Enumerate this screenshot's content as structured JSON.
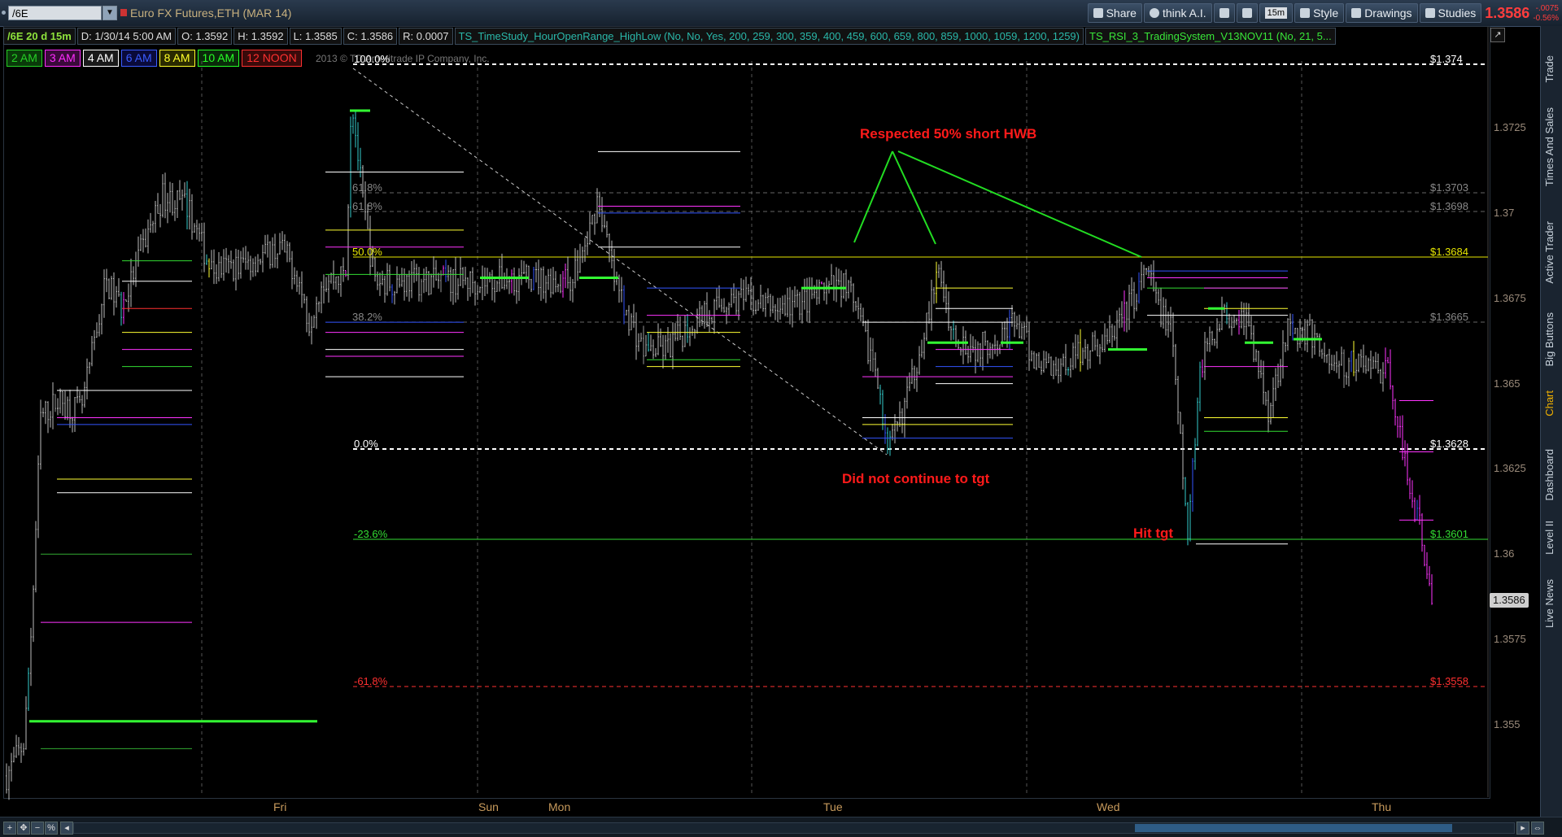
{
  "toolbar": {
    "symbol": "/6E",
    "description": "Euro FX Futures,ETH (MAR 14)",
    "buttons": {
      "share": "Share",
      "think_ai": "think A.I.",
      "interval": "15m",
      "style": "Style",
      "drawings": "Drawings",
      "studies": "Studies"
    },
    "last_price": "1.3586",
    "change_abs": "-.0075",
    "change_pct": "-0.56%"
  },
  "info_bar": {
    "symbol_period": "/6E 20 d 15m",
    "date": "D: 1/30/14 5:00 AM",
    "open": "O: 1.3592",
    "high": "H: 1.3592",
    "low": "L: 1.3585",
    "close": "C: 1.3586",
    "range": "R: 0.0007",
    "study1": "TS_TimeStudy_HourOpenRange_HighLow (No, No, Yes, 200, 259, 300, 359, 400, 459, 600, 659, 800, 859, 1000, 1059, 1200, 1259)",
    "study2": "TS_RSI_3_TradingSystem_V13NOV11 (No, 21, 5..."
  },
  "hour_legend": [
    {
      "label": "2 AM",
      "color": "#26d026",
      "bg": "#0a3a0a"
    },
    {
      "label": "3 AM",
      "color": "#ff2cff",
      "bg": "#3a0a3a"
    },
    {
      "label": "4 AM",
      "color": "#ffffff",
      "bg": "#1a1a1a"
    },
    {
      "label": "6 AM",
      "color": "#3a5cff",
      "bg": "#0a0a3a"
    },
    {
      "label": "8 AM",
      "color": "#ffff2a",
      "bg": "#2a2a00"
    },
    {
      "label": "10 AM",
      "color": "#26ff26",
      "bg": "#0a2a0a"
    },
    {
      "label": "12 NOON",
      "color": "#ff3030",
      "bg": "#3a0a0a"
    }
  ],
  "copyright": "2013 © TD Ameritrade IP Company, Inc.",
  "right_tabs": [
    "Trade",
    "Times And Sales",
    "Active Trader",
    "Big Buttons",
    "Chart",
    "Dashboard",
    "Level II",
    "Live News"
  ],
  "chart": {
    "x_labels": [
      "Fri",
      "Sun",
      "Mon",
      "Tue",
      "Wed",
      "Thu"
    ],
    "y_ticks": [
      "1.3725",
      "1.37",
      "1.3675",
      "1.365",
      "1.3625",
      "1.36",
      "1.3575",
      "1.355"
    ],
    "current_price": "1.3586",
    "fib_levels": [
      {
        "label": "100.0%",
        "price": "$1.374",
        "color": "#ffffff"
      },
      {
        "label": "61.8%",
        "price": "$1.3703",
        "color": "#888888"
      },
      {
        "label": "61.8%",
        "price": "$1.3698",
        "color": "#888888"
      },
      {
        "label": "50.0%",
        "price": "$1.3684",
        "color": "#e6e600"
      },
      {
        "label": "38.2%",
        "price": "$1.3665",
        "color": "#888888"
      },
      {
        "label": "0.0%",
        "price": "$1.3628",
        "color": "#ffffff"
      },
      {
        "label": "-23.6%",
        "price": "$1.3601",
        "color": "#33dd33"
      },
      {
        "label": "-61.8%",
        "price": "$1.3558",
        "color": "#ff3030"
      }
    ],
    "annotations": {
      "respected": "Respected 50% short  HWB",
      "did_not": "Did not continue to tgt",
      "hit_tgt": "Hit tgt"
    }
  }
}
